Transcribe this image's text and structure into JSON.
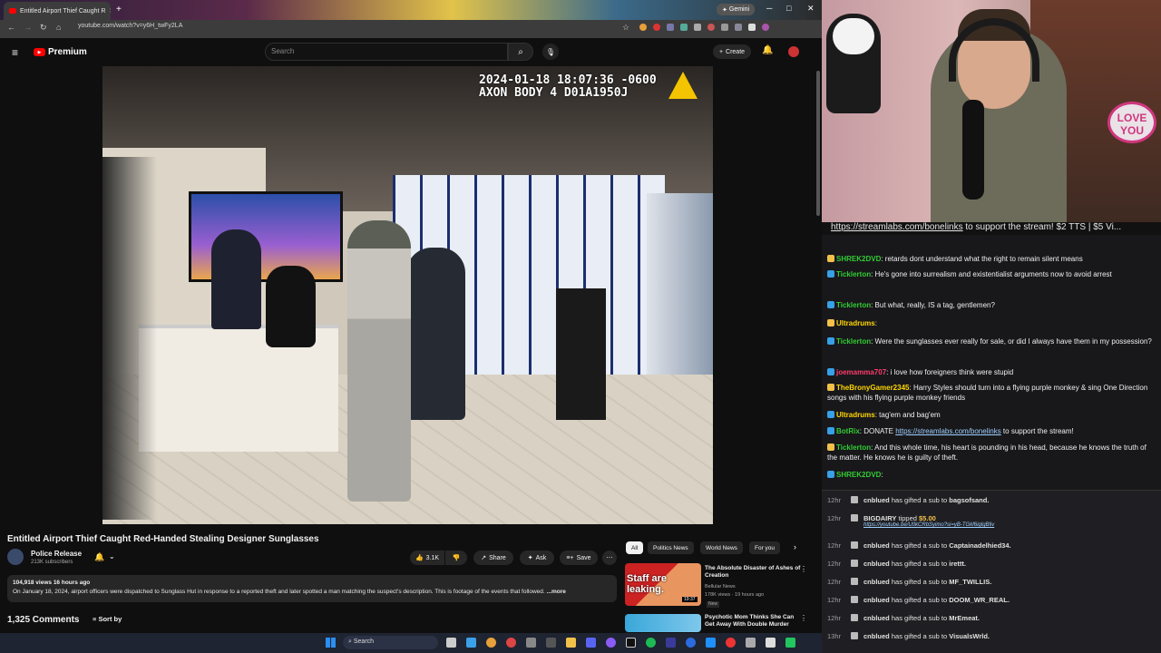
{
  "browser": {
    "tab_title": "Entitled Airport Thief Caught R",
    "url": "youtube.com/watch?v=y6H_twFy2LA",
    "gemini_label": "Gemini"
  },
  "youtube": {
    "logo_text": "Premium",
    "search_placeholder": "Search",
    "create_label": "Create",
    "video": {
      "timestamp_line1": "2024-01-18 18:07:36 -0600",
      "timestamp_line2": "AXON BODY 4 D01A1950J",
      "title": "Entitled Airport Thief Caught Red-Handed Stealing Designer Sunglasses",
      "channel_name": "Police Release",
      "channel_subs": "213K subscribers",
      "likes": "3.1K",
      "share_label": "Share",
      "ask_label": "Ask",
      "save_label": "Save",
      "views_date": "104,918 views  16 hours ago",
      "description": "On January 18, 2024, airport officers were dispatched to Sunglass Hut in response to a reported theft and later spotted a man matching the suspect's description. This is footage of the events that followed.",
      "more_label": "...more",
      "comments_count": "1,325 Comments",
      "sort_label": "Sort by"
    },
    "chips": [
      "All",
      "Politics News",
      "World News",
      "For you"
    ],
    "related": [
      {
        "thumb_text": "Staff are leaking.",
        "duration": "19:37",
        "title": "The Absolute Disaster of Ashes of Creation",
        "channel": "Bellular News",
        "meta": "178K views · 19 hours ago",
        "badge": "New"
      },
      {
        "title": "Psychotic Mom Thinks She Can Get Away With Double Murder"
      }
    ]
  },
  "taskbar": {
    "search_label": "Search"
  },
  "webcam": {
    "sign_text": "LOVE YOU"
  },
  "chat": {
    "banner_link": "https://streamlabs.com/bonelinks",
    "banner_rest": " to support the stream! $2 TTS | $5 Vi...",
    "messages": [
      {
        "user": "SHREK2DVD",
        "color": "#32cd32",
        "text": "retards dont understand what the right to remain silent means"
      },
      {
        "user": "Ticklerton",
        "color": "#32cd32",
        "text": "He's gone into surrealism and existentialist arguments now to avoid arrest"
      },
      {
        "user": "Ticklerton",
        "color": "#32cd32",
        "text": "But what, really, IS a tag, gentlemen?"
      },
      {
        "user": "Ultradrums",
        "color": "#ffd700",
        "text": ""
      },
      {
        "user": "Ticklerton",
        "color": "#32cd32",
        "text": "Were the sunglasses ever really for sale, or did I always have them in my possession?"
      },
      {
        "user": "joemamma707",
        "color": "#ff3b6b",
        "text": "i love how foreigners think were stupid"
      },
      {
        "user": "TheBronyGamer2345",
        "color": "#ffd700",
        "text": "Harry Styles should turn into a flying purple monkey & sing One Direction songs with his flying purple monkey friends"
      },
      {
        "user": "Ultradrums",
        "color": "#ffd700",
        "text": "tag'em and bag'em"
      },
      {
        "user": "BotRix",
        "color": "#32cd32",
        "text": "DONATE ",
        "link": "https://streamlabs.com/bonelinks",
        "after": " to support the stream!"
      },
      {
        "user": "Ticklerton",
        "color": "#32cd32",
        "text": "And this whole time, his heart is pounding in his head, because he knows the truth of the matter. He knows he is guilty of theft."
      },
      {
        "user": "SHREK2DVD",
        "color": "#32cd32",
        "text": ""
      }
    ],
    "events": [
      {
        "time": "12hr",
        "user": "cnblued",
        "text": "has gifted a sub to",
        "target": "bagsofsand."
      },
      {
        "time": "12hr",
        "user": "BIGDAIRY",
        "text": "tipped",
        "target": "$5.00",
        "sub": "https://youtube.be/U0kCRbSyimo?si=yB-TGkf6iglgBliv"
      },
      {
        "time": "12hr",
        "user": "cnblued",
        "text": "has gifted a sub to",
        "target": "Captainadelhied34."
      },
      {
        "time": "12hr",
        "user": "cnblued",
        "text": "has gifted a sub to",
        "target": "irettt."
      },
      {
        "time": "12hr",
        "user": "cnblued",
        "text": "has gifted a sub to",
        "target": "MF_TWILLIS."
      },
      {
        "time": "12hr",
        "user": "cnblued",
        "text": "has gifted a sub to",
        "target": "DOOM_WR_REAL."
      },
      {
        "time": "12hr",
        "user": "cnblued",
        "text": "has gifted a sub to",
        "target": "MrEmeat."
      },
      {
        "time": "13hr",
        "user": "cnblued",
        "text": "has gifted a sub to",
        "target": "VisualsWrld."
      }
    ]
  }
}
